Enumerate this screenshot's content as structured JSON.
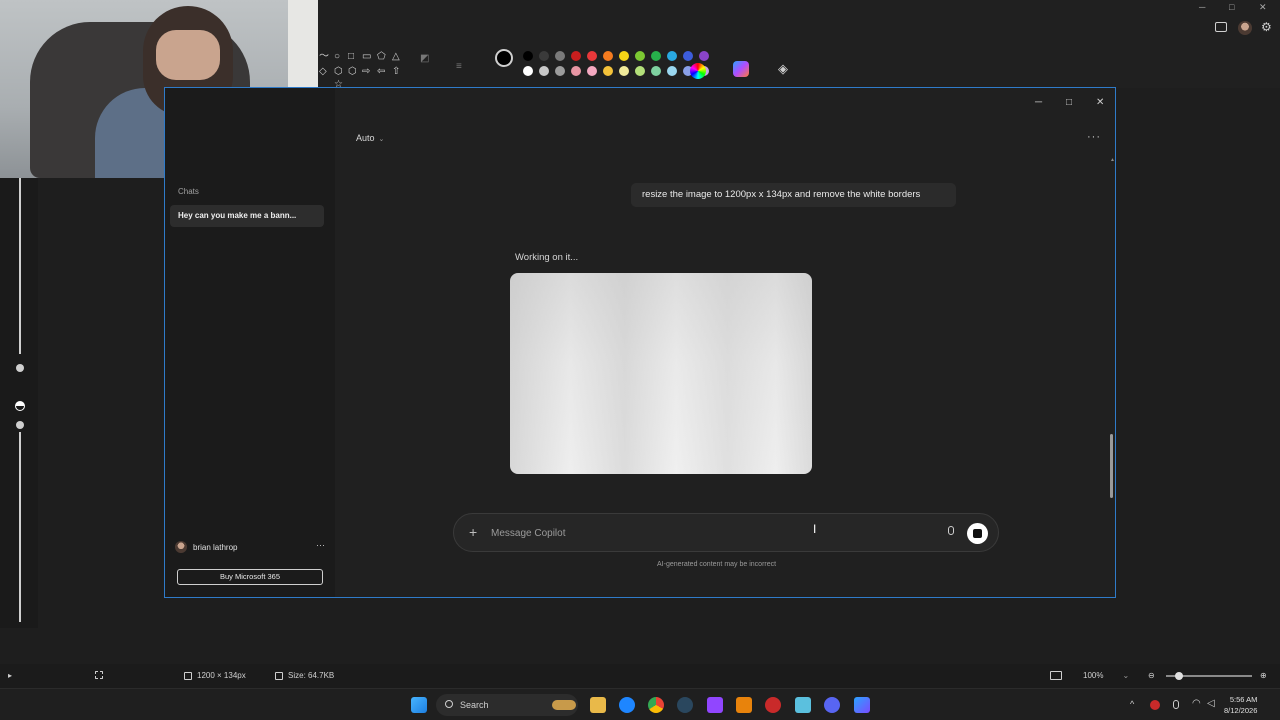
{
  "paint": {
    "statusbar": {
      "dimensions": "1200 × 134px",
      "size": "Size: 64.7KB",
      "zoom": "100%"
    },
    "palette_colors": [
      "#000000",
      "#3a3a3a",
      "#7a7a7a",
      "#c81e1e",
      "#e8383a",
      "#f47b1f",
      "#f5d416",
      "#7cc832",
      "#27b04b",
      "#29a8e0",
      "#3d5ddb",
      "#8a44c8",
      "#ffffff",
      "#c8c8c8",
      "#9c9c9c",
      "#e896a4",
      "#f4a8c0",
      "#f4c23a",
      "#f1ea9a",
      "#b4e07a",
      "#7fd1a0",
      "#9ad7ef",
      "#8aa0e8",
      "#c8a4e8"
    ]
  },
  "copilot": {
    "sidebar": {
      "chats_label": "Chats",
      "chat_items": [
        "Hey can you make me a bann..."
      ],
      "user_name": "brian lathrop",
      "user_more": "···",
      "buy_label": "Buy Microsoft 365"
    },
    "header": {
      "mode": "Auto",
      "more": "···"
    },
    "window_controls": {
      "minimize": "─",
      "maximize": "□",
      "close": "✕"
    },
    "conversation": {
      "user_message": "resize the image to 1200px x 134px and remove the white borders",
      "status": "Working on it..."
    },
    "composer": {
      "placeholder": "Message Copilot",
      "value": "",
      "plus": "+"
    },
    "disclaimer": "AI-generated content may be incorrect"
  },
  "taskbar": {
    "search_label": "Search",
    "time": "5:56 AM",
    "date": "8/12/2026"
  }
}
